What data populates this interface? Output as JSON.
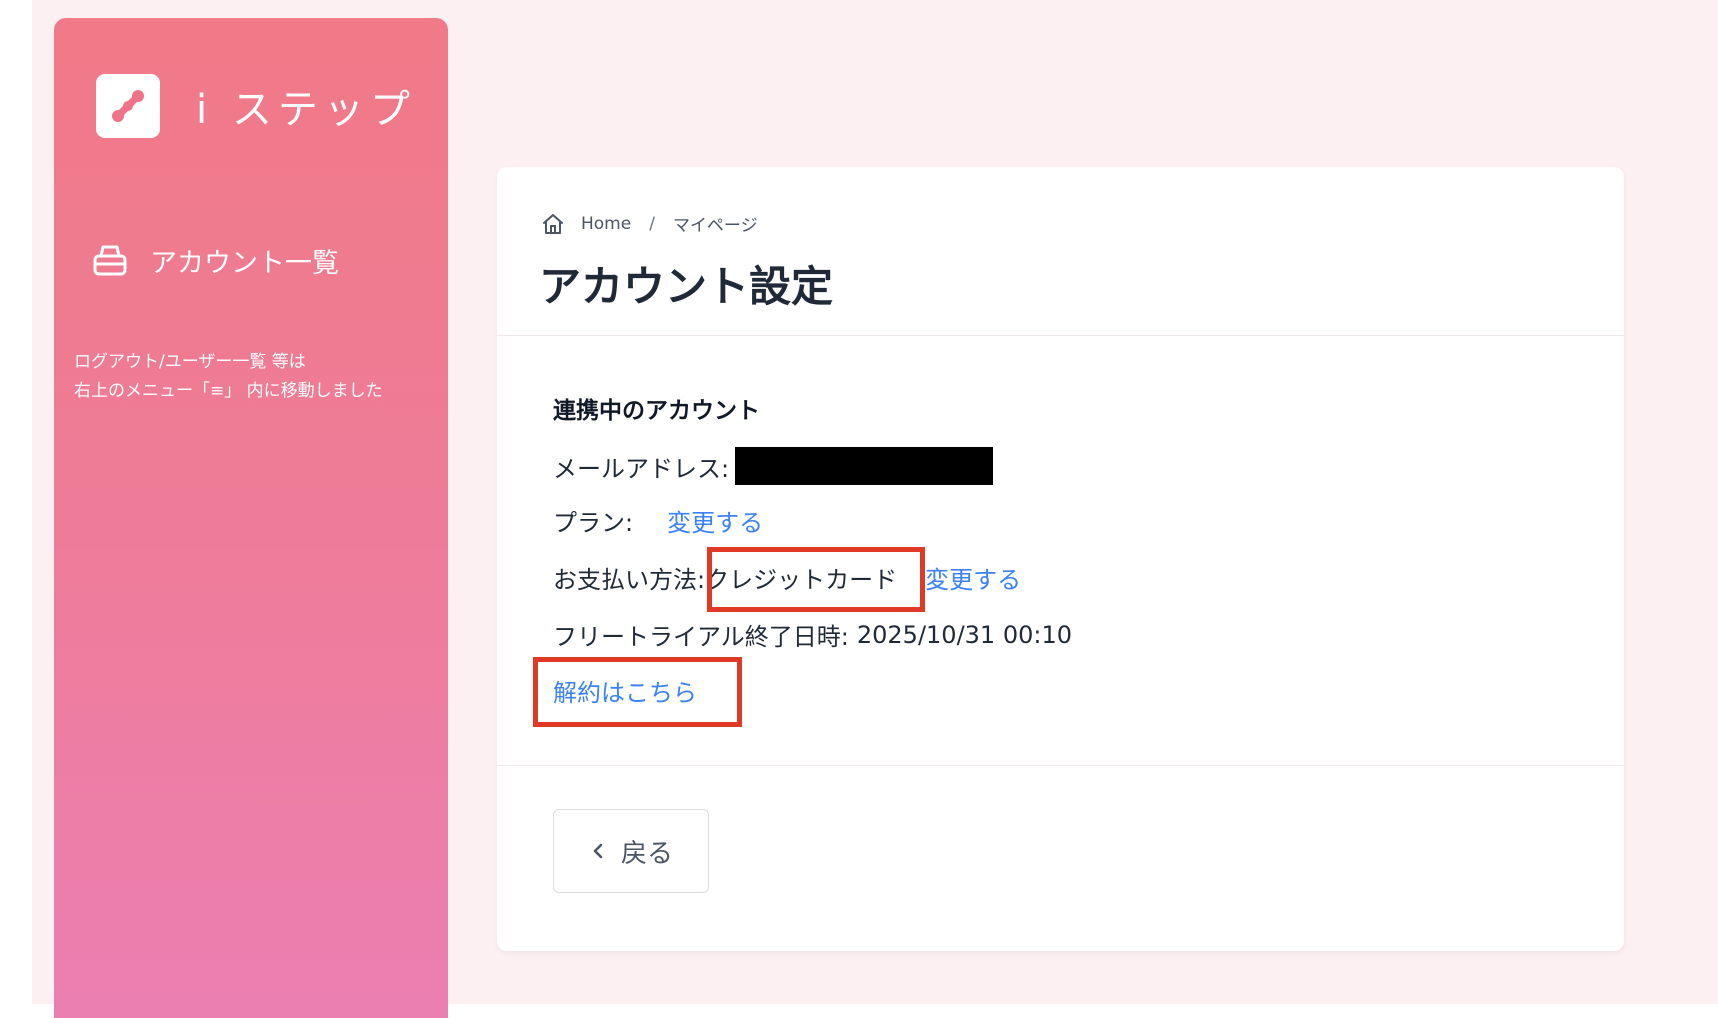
{
  "sidebar": {
    "brand_name": "i ステップ",
    "nav_item_label": "アカウント一覧",
    "notice_lines": [
      "ログアウト/ユーザー一覧 等は",
      "右上のメニュー「≡」 内に移動しました"
    ]
  },
  "breadcrumb": {
    "home": "Home",
    "separator": "/",
    "current": "マイページ"
  },
  "page_title": "アカウント設定",
  "account": {
    "section_title": "連携中のアカウント",
    "email_label": "メールアドレス:",
    "plan_label": "プラン:",
    "plan_change": "変更する",
    "payment_label": "お支払い方法:",
    "payment_value": "クレジットカード",
    "payment_change": "変更する",
    "trial_label": "フリートライアル終了日時:",
    "trial_value": "2025/10/31 00:10",
    "cancel_link": "解約はこちら"
  },
  "back_button": "戻る",
  "colors": {
    "sidebar_top": "#f07a87",
    "sidebar_bottom": "#ec7fb2",
    "link": "#3b82f6",
    "highlight": "#e03a26",
    "background": "#fdf0f3"
  }
}
